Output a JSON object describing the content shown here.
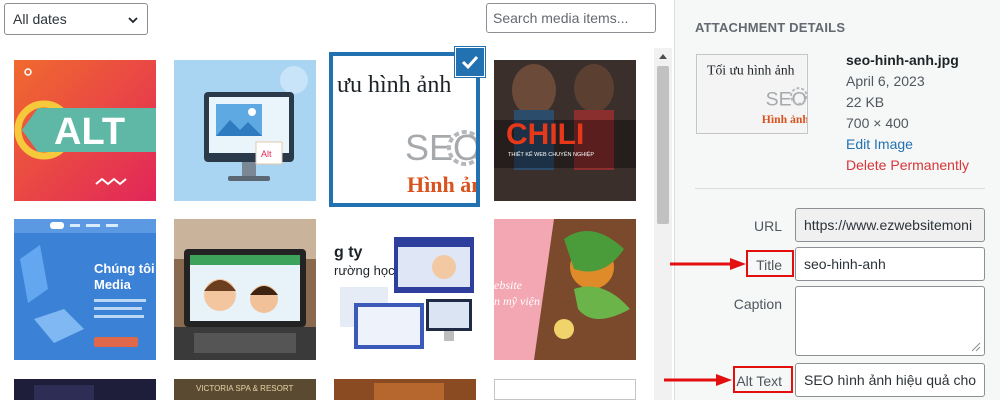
{
  "media_library": {
    "date_filter": "All dates",
    "search_placeholder": "Search media items...",
    "thumbnails": [
      {
        "name": "alt-graphic",
        "text": "ALT"
      },
      {
        "name": "computer-alt-graphic",
        "text": "Alt"
      },
      {
        "name": "seo-hinh-anh",
        "text_top": "ưu hình ảnh",
        "text_seo": "SEO",
        "text_bottom": "Hình ản",
        "selected": true
      },
      {
        "name": "chili-web",
        "text": "CHILI",
        "subtext": "THIẾT KẾ WEB CHUYÊN NGHIỆP"
      },
      {
        "name": "media-website",
        "text": "Chúng tôi",
        "text2": "Media"
      },
      {
        "name": "laptop-kids"
      },
      {
        "name": "school-website",
        "text": "g ty",
        "text2": "rường học"
      },
      {
        "name": "beauty-website",
        "text": "ebsite",
        "text2": "n mỹ viện"
      },
      {
        "name": "dark-photo"
      },
      {
        "name": "victoria-spa",
        "text": "VICTORIA SPA & RESORT"
      },
      {
        "name": "orange-photo"
      },
      {
        "name": "blank-photo"
      }
    ]
  },
  "details": {
    "heading": "ATTACHMENT DETAILS",
    "preview": {
      "line1": "Tối ưu hình ảnh",
      "line2": "SEO",
      "line3": "Hình ảnh"
    },
    "file_name": "seo-hinh-anh.jpg",
    "date": "April 6, 2023",
    "size": "22 KB",
    "dimensions": "700 × 400",
    "edit_label": "Edit Image",
    "delete_label": "Delete Permanently",
    "fields": {
      "url_label": "URL",
      "url_value": "https://www.ezwebsitemoni",
      "title_label": "Title",
      "title_value": "seo-hinh-anh",
      "caption_label": "Caption",
      "caption_value": "",
      "alt_label": "Alt Text",
      "alt_value": "SEO hình ảnh hiệu quả cho"
    }
  },
  "colors": {
    "accent": "#2271b1",
    "annotation": "#e30e0e",
    "delete": "#d63638"
  }
}
